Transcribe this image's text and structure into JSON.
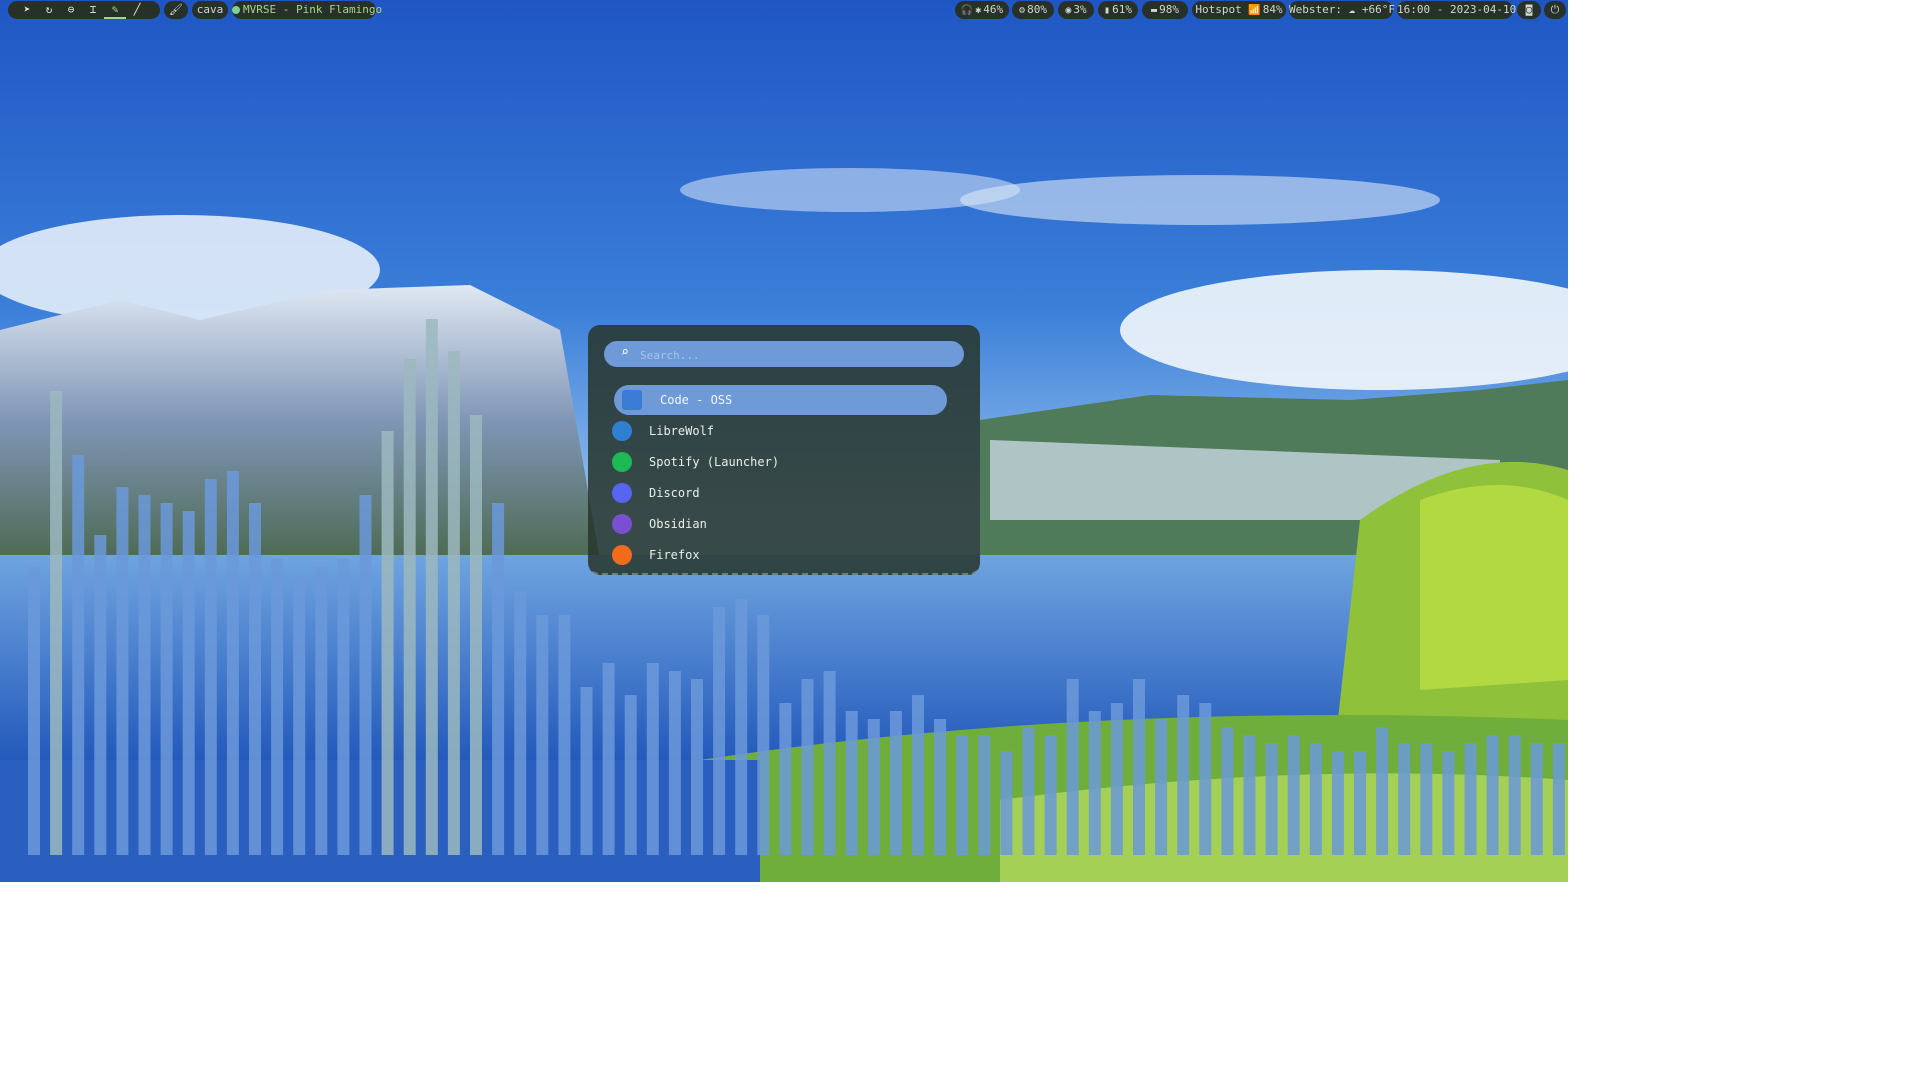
{
  "topbar": {
    "tool_icons": [
      "send-icon",
      "refresh-icon",
      "circle-icon",
      "pin-icon",
      "draw-icon",
      "pencil-icon"
    ],
    "brush_icon": "brush-icon",
    "cava_label": "cava",
    "music": "MVRSE - Pink Flamingo",
    "audio": "46%",
    "cpu": "80%",
    "memory": "3%",
    "disk": "61%",
    "battery": "98%",
    "network": "Hotspot",
    "wifi": "84%",
    "weather": "Webster: ☁ +66°F",
    "clock": "16:00 - 2023-04-10"
  },
  "launcher": {
    "search_placeholder": "Search...",
    "apps": [
      {
        "label": "Code - OSS",
        "icon": "code-oss-icon",
        "color": "#3a7bd5",
        "selected": true
      },
      {
        "label": "LibreWolf",
        "icon": "librewolf-icon",
        "color": "#2f7fd2"
      },
      {
        "label": "Spotify (Launcher)",
        "icon": "spotify-icon",
        "color": "#1db954"
      },
      {
        "label": "Discord",
        "icon": "discord-icon",
        "color": "#5865f2"
      },
      {
        "label": "Obsidian",
        "icon": "obsidian-icon",
        "color": "#7b4fd4"
      },
      {
        "label": "Firefox",
        "icon": "firefox-icon",
        "color": "#f26b1d"
      }
    ]
  },
  "cava": {
    "levels": [
      0.36,
      0.58,
      0.5,
      0.4,
      0.46,
      0.45,
      0.44,
      0.43,
      0.47,
      0.48,
      0.44,
      0.37,
      0.35,
      0.36,
      0.37,
      0.45,
      0.53,
      0.62,
      0.67,
      0.63,
      0.55,
      0.44,
      0.33,
      0.3,
      0.3,
      0.21,
      0.24,
      0.2,
      0.24,
      0.23,
      0.22,
      0.31,
      0.32,
      0.3,
      0.19,
      0.22,
      0.23,
      0.18,
      0.17,
      0.18,
      0.2,
      0.17,
      0.15,
      0.15,
      0.13,
      0.16,
      0.15,
      0.22,
      0.18,
      0.19,
      0.22,
      0.17,
      0.2,
      0.19,
      0.16,
      0.15,
      0.14,
      0.15,
      0.14,
      0.13,
      0.13,
      0.16,
      0.14,
      0.14,
      0.13,
      0.14,
      0.15,
      0.15,
      0.14,
      0.14,
      0.21
    ]
  }
}
